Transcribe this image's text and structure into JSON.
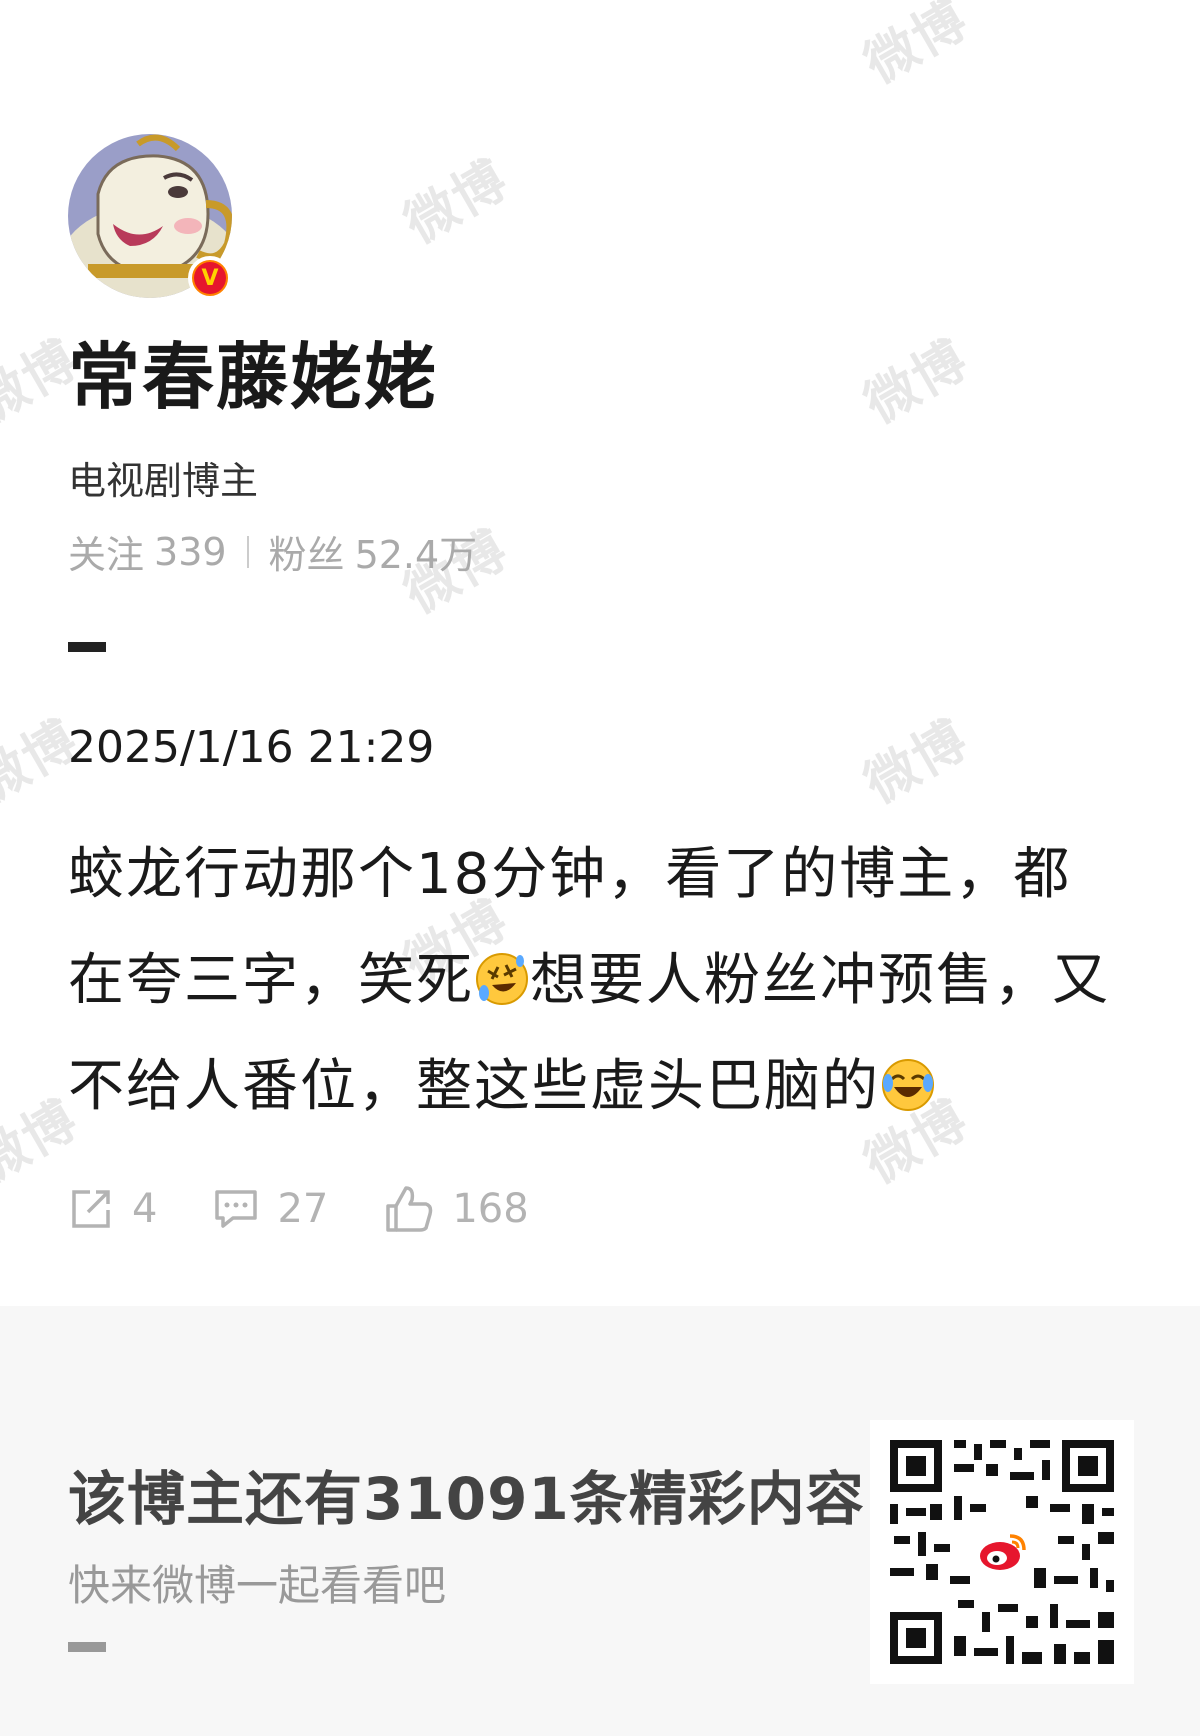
{
  "watermark": "微博",
  "profile": {
    "name": "常春藤姥姥",
    "role": "电视剧博主",
    "following_label": "关注",
    "following_count": "339",
    "followers_label": "粉丝",
    "followers_count": "52.4万",
    "verified_icon": "verified-v-badge"
  },
  "post": {
    "time": "2025/1/16 21:29",
    "text_1": "蛟龙行动那个18分钟，看了的博主，都在夸三字，笑死",
    "emoji_1": "rofl-emoji",
    "text_2": "想要人粉丝冲预售，又不给人番位，整这些虚头巴脑的",
    "emoji_2": "crying-laugh-emoji",
    "reposts": "4",
    "comments": "27",
    "likes": "168"
  },
  "footer": {
    "title": "该博主还有31091条精彩内容",
    "subtitle": "快来微博一起看看吧",
    "qr_icon": "weibo-qr-code"
  }
}
